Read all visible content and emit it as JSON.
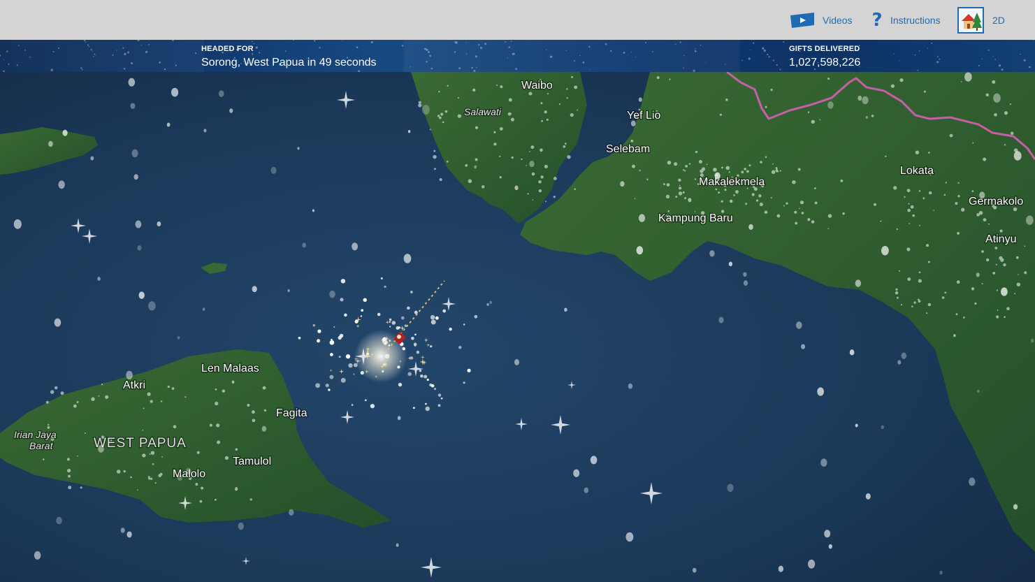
{
  "topbar": {
    "videos_label": "Videos",
    "instructions_label": "Instructions",
    "view_label": "2D"
  },
  "status": {
    "headed_for_label": "HEADED FOR",
    "headed_for_value": "Sorong, West Papua in 49 seconds",
    "gifts_label": "GIFTS DELIVERED",
    "gifts_value": "1,027,598,226"
  },
  "map": {
    "labels": {
      "waibo": "Waibo",
      "salawati": "Salawati",
      "yef_lio": "Yef Lio",
      "selebam": "Selebam",
      "makalekmela": "Makalekmela",
      "kampung_baru": "Kampung Baru",
      "lokata": "Lokata",
      "germakolo": "Germakolo",
      "atinyu": "Atinyu",
      "len_malaas": "Len Malaas",
      "atkri": "Atkri",
      "fagita": "Fagita",
      "irian_jaya": "Irian Jaya",
      "barat": "Barat",
      "west_papua": "WEST PAPUA",
      "tamulol": "Tamulol",
      "malolo": "Malolo"
    },
    "colors": {
      "sea": "#1c3a5c",
      "land": "#2e5a2c",
      "border": "#c75fa8"
    }
  }
}
